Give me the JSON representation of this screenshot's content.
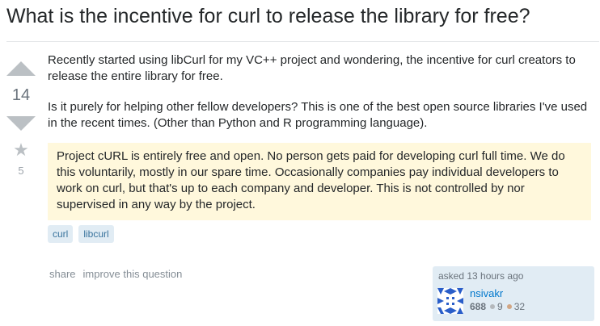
{
  "question": {
    "title": "What is the incentive for curl to release the library for free?",
    "vote_count": "14",
    "favorite_count": "5",
    "body": [
      "Recently started using libCurl for my VC++ project and wondering, the incentive for curl creators to release the entire library for free.",
      "Is it purely for helping other fellow developers? This is one of the best open source libraries I've used in the recent times. (Other than Python and R programming language)."
    ],
    "quote": "Project cURL is entirely free and open. No person gets paid for developing curl full time. We do this voluntarily, mostly in our spare time. Occasionally companies pay individual developers to work on curl, but that's up to each company and developer. This is not controlled by nor supervised in any way by the project.",
    "tags": [
      "curl",
      "libcurl"
    ]
  },
  "menu": {
    "share": "share",
    "improve": "improve this question"
  },
  "owner": {
    "asked": "asked 13 hours ago",
    "name": "nsivakr",
    "reputation": "688",
    "silver_badges": "9",
    "bronze_badges": "32"
  },
  "icons": {
    "upvote": "upvote-arrow-icon",
    "downvote": "downvote-arrow-icon",
    "favorite": "star-icon",
    "avatar": "identicon"
  },
  "colors": {
    "accent_link": "#0077cc",
    "quote_bg": "#fff8dc",
    "tag_bg": "#e1ecf4",
    "tag_text": "#39739d",
    "silver": "#b4b8bc",
    "bronze": "#d1a684"
  }
}
